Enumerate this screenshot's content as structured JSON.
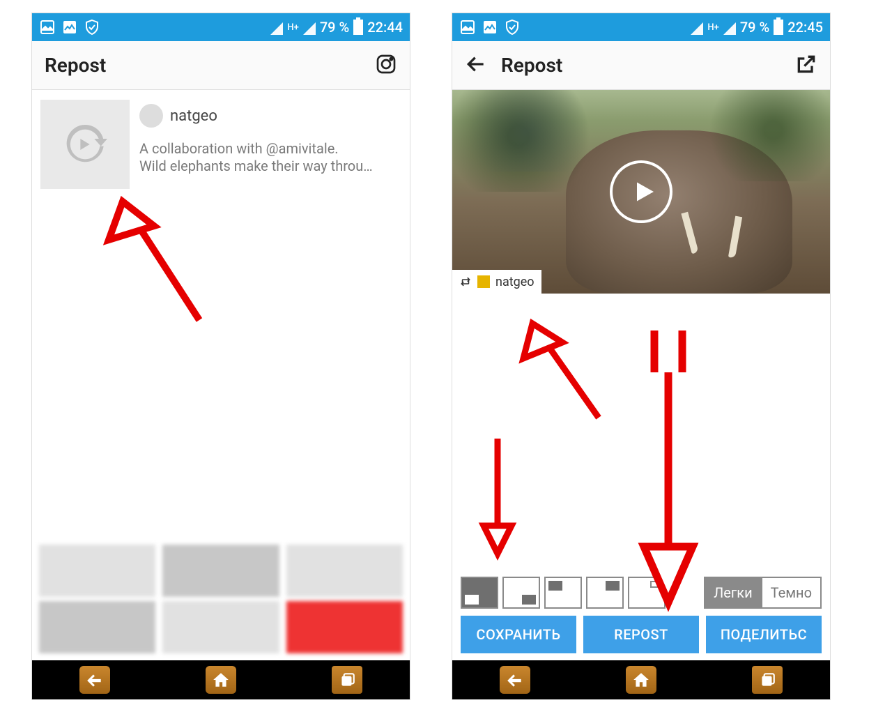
{
  "left": {
    "status": {
      "battery": "79 %",
      "time": "22:44",
      "netlabel": "H+"
    },
    "appbar": {
      "title": "Repost"
    },
    "item": {
      "username": "natgeo",
      "caption_l1": "A collaboration with @amivitale.",
      "caption_l2": "Wild elephants make their way throu…"
    }
  },
  "right": {
    "status": {
      "battery": "79 %",
      "time": "22:45",
      "netlabel": "H+"
    },
    "appbar": {
      "title": "Repost"
    },
    "badge_user": "natgeo",
    "theme": {
      "light": "Легки",
      "dark": "Темно"
    },
    "buttons": {
      "save": "СОХРАНИТЬ",
      "repost": "REPOST",
      "share": "ПОДЕЛИТЬС"
    }
  }
}
